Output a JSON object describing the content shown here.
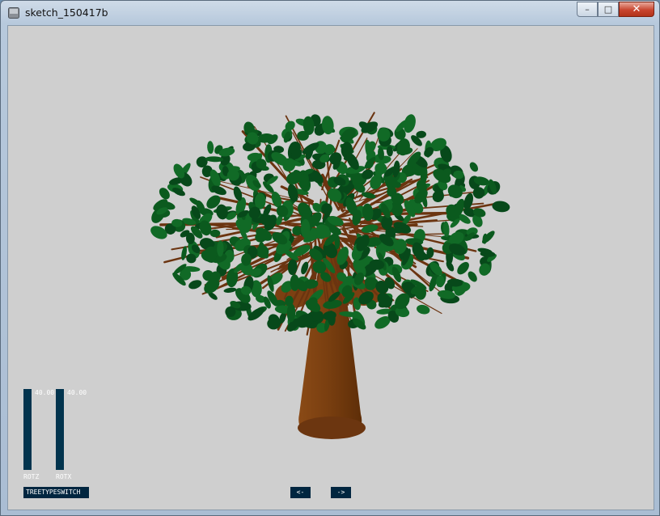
{
  "window": {
    "title": "sketch_150417b"
  },
  "icons": {
    "app": "sketch-window-icon",
    "minimize": "minimize-icon",
    "maximize": "maximize-icon",
    "close": "close-icon"
  },
  "colors": {
    "canvas_bg": "#cfcfcf",
    "trunk": "#7a3f10",
    "branch": "#6b3410",
    "leaf": "#0b5a1e",
    "widget_bg": "#02344e",
    "button_bg": "#012640"
  },
  "sliders": [
    {
      "label": "ROTZ",
      "value": "40.00"
    },
    {
      "label": "ROTX",
      "value": "40.00"
    }
  ],
  "buttons": {
    "tree_type_switch": "TREETYPESWITCH",
    "prev": "<-",
    "next": "->"
  }
}
